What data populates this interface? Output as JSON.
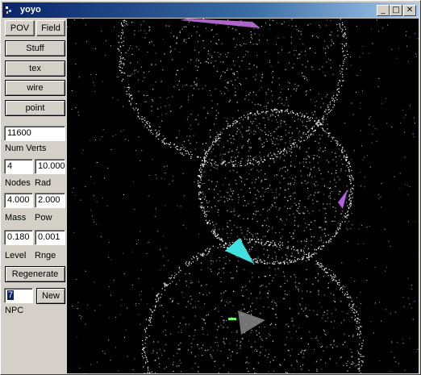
{
  "window": {
    "title": "yoyo"
  },
  "titlebar_buttons": {
    "minimize": "_",
    "maximize": "□",
    "close": "✕"
  },
  "sidebar": {
    "pov_label": "POV",
    "field_label": "Field",
    "stuff_label": "Stuff",
    "tex_label": "tex",
    "wire_label": "wire",
    "point_label": "point",
    "num_verts_value": "11600",
    "num_verts_label": "Num Verts",
    "nodes_value": "4",
    "rad_value": "10.000",
    "nodes_label": "Nodes",
    "rad_label": "Rad",
    "mass_value": "4.000",
    "pow_value": "2.000",
    "mass_label": "Mass",
    "pow_label": "Pow",
    "level_value": "0.180",
    "rnge_value": "0.001",
    "level_label": "Level",
    "rnge_label": "Rnge",
    "regenerate_label": "Regenerate",
    "npc_value": "7",
    "new_label": "New",
    "npc_label": "NPC"
  },
  "colors": {
    "titlebar_start": "#0a246a",
    "viewport_bg": "#000000",
    "pink_shard": "#d070e0",
    "cyan_shard": "#40e0e0",
    "gray_shard": "#8a8a8a"
  }
}
